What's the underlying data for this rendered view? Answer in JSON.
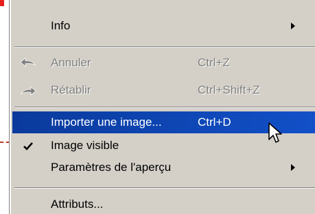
{
  "menu": {
    "items": [
      {
        "label": "Info",
        "shortcut": "",
        "submenu": true,
        "state": "normal"
      },
      {
        "label": "Annuler",
        "shortcut": "Ctrl+Z",
        "icon": "undo-arrow-icon",
        "state": "disabled"
      },
      {
        "label": "Rétablir",
        "shortcut": "Ctrl+Shift+Z",
        "icon": "redo-arrow-icon",
        "state": "disabled"
      },
      {
        "label": "Importer une image...",
        "shortcut": "Ctrl+D",
        "state": "highlighted"
      },
      {
        "label": "Image visible",
        "shortcut": "",
        "icon": "checkmark-icon",
        "checked": true,
        "state": "normal"
      },
      {
        "label": "Paramètres de l'aperçu",
        "shortcut": "",
        "submenu": true,
        "state": "normal"
      },
      {
        "label": "Attributs...",
        "shortcut": "",
        "state": "normal"
      }
    ]
  },
  "colors": {
    "menu_bg": "#d4d0c8",
    "highlight_bg": "#0a3a9c",
    "disabled_text": "#808080",
    "accent_red": "#e8201c"
  },
  "cursor": {
    "icon": "mouse-pointer-icon"
  }
}
